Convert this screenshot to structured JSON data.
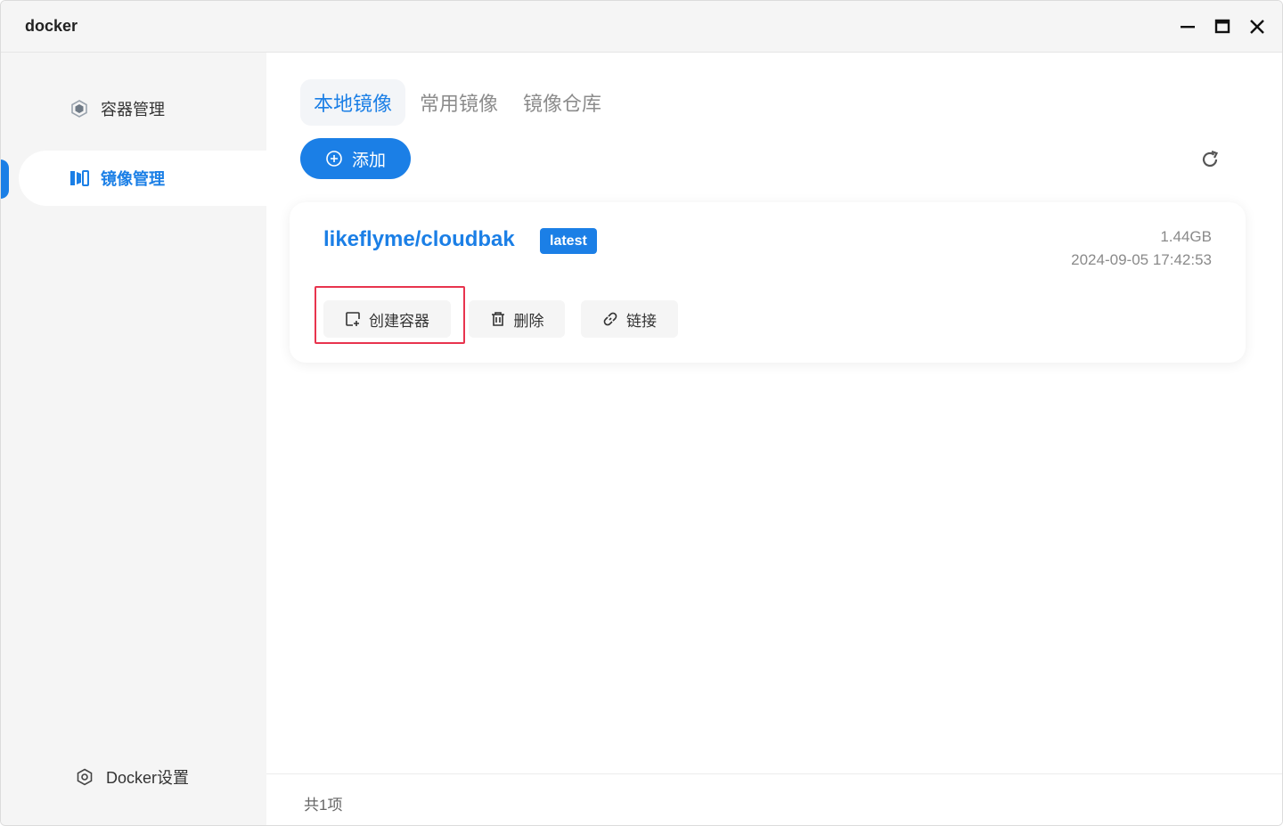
{
  "window": {
    "title": "docker"
  },
  "sidebar": {
    "items": [
      {
        "label": "容器管理",
        "icon": "container-icon",
        "active": false
      },
      {
        "label": "镜像管理",
        "icon": "image-icon",
        "active": true
      }
    ],
    "settings_label": "Docker设置",
    "accent_color": "#1b7fe6"
  },
  "main": {
    "tabs": [
      {
        "label": "本地镜像",
        "active": true
      },
      {
        "label": "常用镜像",
        "active": false
      },
      {
        "label": "镜像仓库",
        "active": false
      }
    ],
    "add_label": "添加",
    "images": [
      {
        "name": "likeflyme/cloudbak",
        "tag": "latest",
        "size": "1.44GB",
        "created": "2024-09-05 17:42:53",
        "actions": {
          "create": "创建容器",
          "delete": "删除",
          "link": "链接"
        }
      }
    ],
    "total_label": "共1项"
  }
}
